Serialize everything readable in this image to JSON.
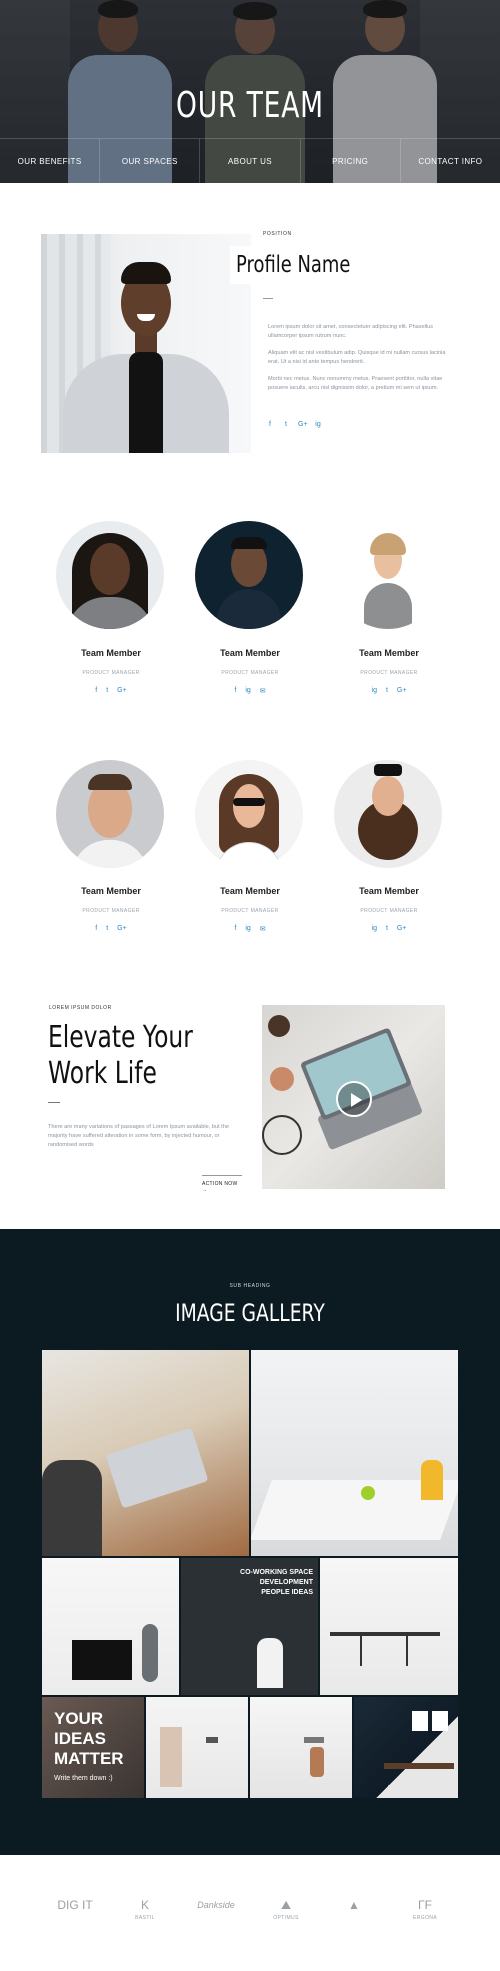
{
  "hero": {
    "title": "OUR TEAM",
    "nav": [
      "OUR BENEFITS",
      "OUR SPACES",
      "ABOUT US",
      "PRICING",
      "CONTACT INFO"
    ]
  },
  "profile": {
    "position_label": "POSITION",
    "name": "Profile Name",
    "paragraphs": [
      "Lorem ipsum dolor sit amet, consectetuer adipiscing elit. Phasellus ullamcorper ipsum rutrum nunc.",
      "Aliquam elit ac nisl vestibulum adip. Quisque id mi nullam cursus lacinia erat. Ut a nisi id ante tempus hendrerit.",
      "Morbi nec metus. Nunc nonummy metus. Praesent porttitor, nulla vitae posuere iaculis, arcu nisl dignissim dolor, a pretium mi sem ut ipsum."
    ],
    "social": [
      "f",
      "t",
      "G+",
      "ig"
    ]
  },
  "team": [
    {
      "name": "Team Member",
      "role": "PRODUCT MANAGER",
      "social": [
        "f",
        "t",
        "G+"
      ]
    },
    {
      "name": "Team Member",
      "role": "PRODUCT MANAGER",
      "social": [
        "f",
        "ig",
        "✉"
      ]
    },
    {
      "name": "Team Member",
      "role": "PRODUCT MANAGER",
      "social": [
        "ig",
        "t",
        "G+"
      ]
    },
    {
      "name": "Team Member",
      "role": "PRODUCT MANAGER",
      "social": [
        "f",
        "t",
        "G+"
      ]
    },
    {
      "name": "Team Member",
      "role": "PRODUCT MANAGER",
      "social": [
        "f",
        "ig",
        "✉"
      ]
    },
    {
      "name": "Team Member",
      "role": "PRODUCT MANAGER",
      "social": [
        "ig",
        "t",
        "G+"
      ]
    }
  ],
  "elevate": {
    "eyebrow": "LOREM IPSUM DOLOR",
    "title_line1": "Elevate Your",
    "title_line2": "Work Life",
    "text": "There are many variations of passages of Lorem Ipsum available, but the majority have suffered alteration in some form, by injected humour, or randomised words",
    "action": "ACTION NOW"
  },
  "gallery": {
    "eyebrow": "SUB HEADING",
    "title": "IMAGE GALLERY",
    "poster1": "CO-WORKING SPACE DEVELOPMENT PEOPLE IDEAS",
    "poster2_l1": "YOUR",
    "poster2_l2": "IDEAS",
    "poster2_l3": "MATTER",
    "poster2_sub": "Write them down :)"
  },
  "logos": [
    {
      "mark": "DIG IT",
      "word": ""
    },
    {
      "mark": "K",
      "word": "BASTIL"
    },
    {
      "mark": "Dankside",
      "word": ""
    },
    {
      "mark": "⛰",
      "word": "OPTIMUS"
    },
    {
      "mark": "▲",
      "word": ""
    },
    {
      "mark": "ΓF",
      "word": "ERGONA"
    }
  ]
}
